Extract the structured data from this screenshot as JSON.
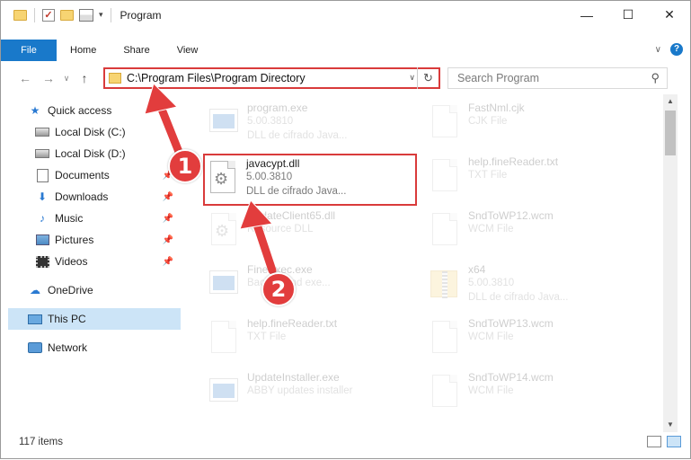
{
  "window": {
    "title": "Program",
    "minimize_glyph": "—",
    "maximize_glyph": "☐",
    "close_glyph": "✕"
  },
  "ribbon": {
    "tabs": [
      "File",
      "Home",
      "Share",
      "View"
    ],
    "expand_glyph": "∨",
    "help_glyph": "?"
  },
  "nav": {
    "back_glyph": "←",
    "forward_glyph": "→",
    "recent_glyph": "∨",
    "up_glyph": "↑",
    "address": "C:\\Program Files\\Program Directory",
    "address_dropdown_glyph": "∨",
    "refresh_glyph": "↻",
    "search_placeholder": "Search Program",
    "search_glyph": "⚲"
  },
  "sidebar": {
    "items": [
      {
        "label": "Quick access",
        "icon": "star-icon",
        "pinned": false
      },
      {
        "label": "Local Disk (C:)",
        "icon": "disk-icon",
        "pinned": false
      },
      {
        "label": "Local Disk (D:)",
        "icon": "disk-icon",
        "pinned": false
      },
      {
        "label": "Documents",
        "icon": "documents-icon",
        "pinned": true
      },
      {
        "label": "Downloads",
        "icon": "download-icon",
        "pinned": true
      },
      {
        "label": "Music",
        "icon": "music-icon",
        "pinned": true
      },
      {
        "label": "Pictures",
        "icon": "pictures-icon",
        "pinned": true
      },
      {
        "label": "Videos",
        "icon": "videos-icon",
        "pinned": true
      },
      {
        "label": "OneDrive",
        "icon": "cloud-icon",
        "pinned": false
      },
      {
        "label": "This PC",
        "icon": "computer-icon",
        "pinned": false,
        "selected": true
      },
      {
        "label": "Network",
        "icon": "network-icon",
        "pinned": false
      }
    ],
    "pin_glyph": "📌"
  },
  "files": {
    "left": [
      {
        "name": "program.exe",
        "sub": "5.00.3810",
        "sub2": "DLL de cifrado Java...",
        "type": "exe"
      },
      {
        "name": "javacypt.dll",
        "sub": "5.00.3810",
        "sub2": "DLL de cifrado Java...",
        "type": "dll",
        "highlighted": true
      },
      {
        "name": "UpdateClient65.dll",
        "sub": "Resource DLL",
        "sub2": "",
        "type": "dll"
      },
      {
        "name": "FineExec.exe",
        "sub": "Background exe...",
        "sub2": "",
        "type": "exe"
      },
      {
        "name": "help.fineReader.txt",
        "sub": "TXT File",
        "sub2": "",
        "type": "txt"
      },
      {
        "name": "UpdateInstaller.exe",
        "sub": "ABBY updates installer",
        "sub2": "",
        "type": "exe"
      }
    ],
    "right": [
      {
        "name": "FastNml.cjk",
        "sub": "CJK File",
        "type": "txt"
      },
      {
        "name": "help.fineReader.txt",
        "sub": "TXT File",
        "type": "txt"
      },
      {
        "name": "SndToWP12.wcm",
        "sub": "WCM File",
        "type": "txt"
      },
      {
        "name": "x64",
        "sub": "5.00.3810",
        "sub2": "DLL de cifrado Java...",
        "type": "zip"
      },
      {
        "name": "SndToWP13.wcm",
        "sub": "WCM File",
        "type": "txt"
      },
      {
        "name": "SndToWP14.wcm",
        "sub": "WCM File",
        "type": "txt"
      }
    ]
  },
  "status": {
    "items_count": "117 items"
  },
  "annotations": {
    "step1": "1",
    "step2": "2",
    "color": "#e23d3d"
  }
}
